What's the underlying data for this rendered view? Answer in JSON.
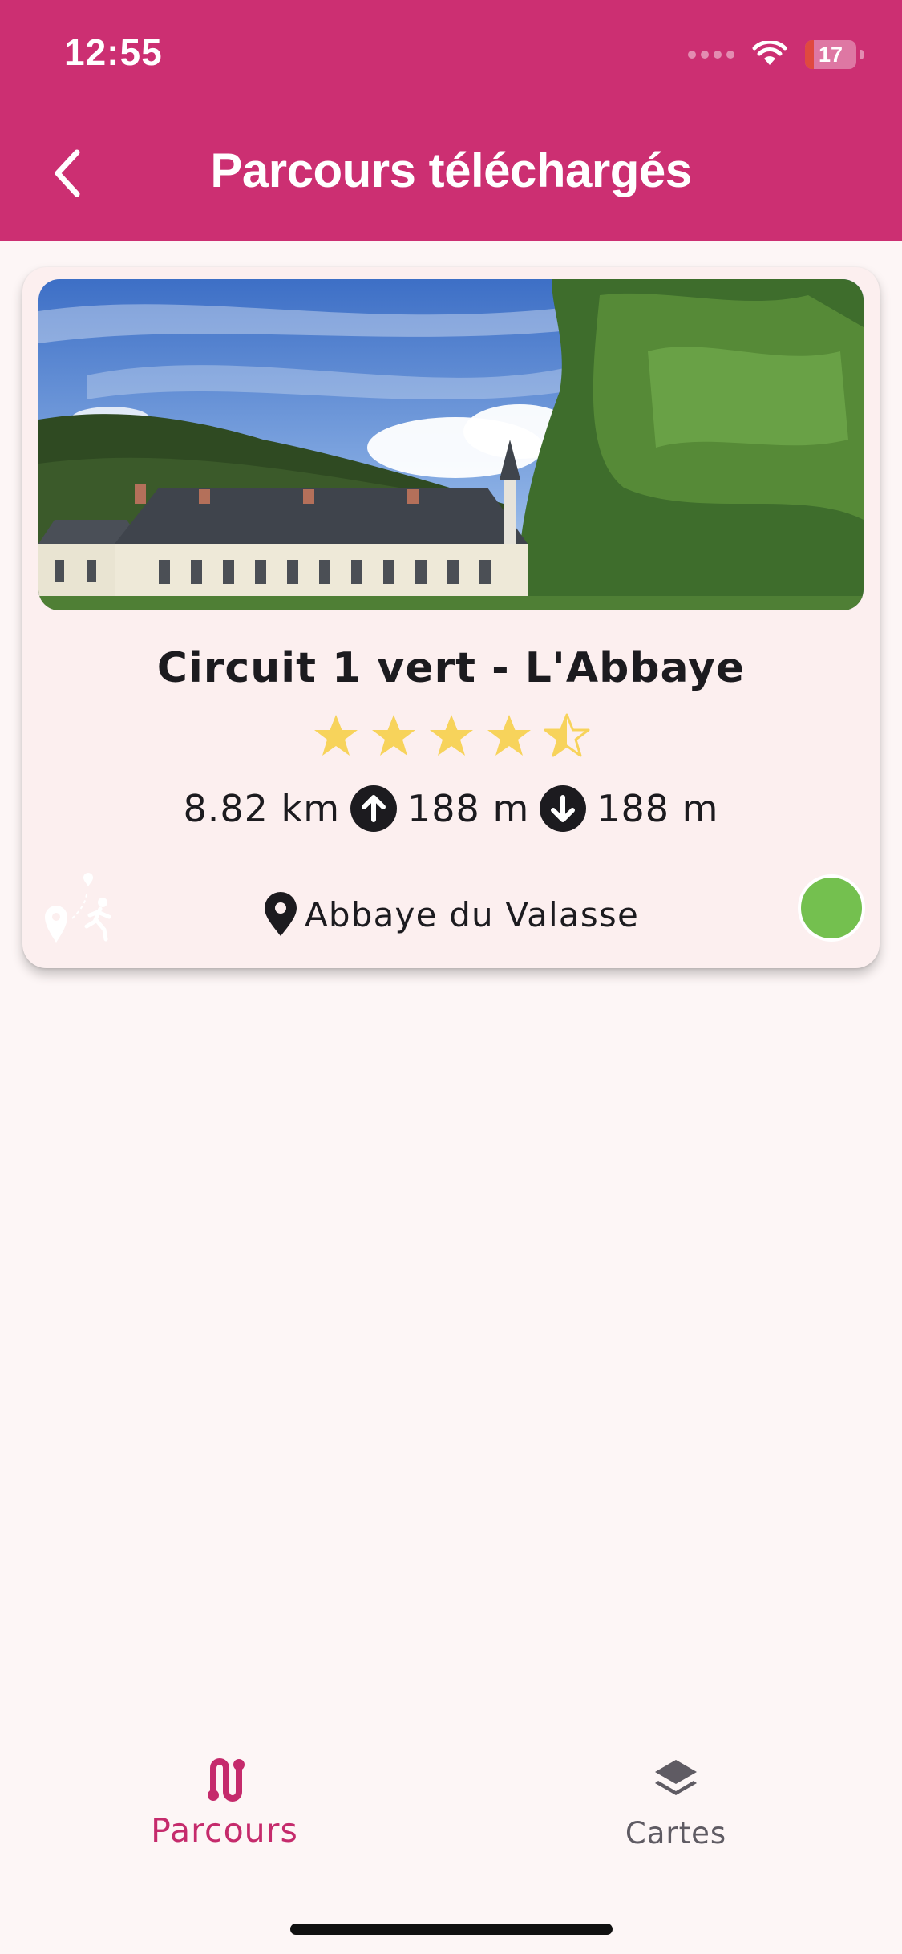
{
  "status_bar": {
    "time": "12:55",
    "battery_level": "17",
    "battery_fraction": 0.17
  },
  "header": {
    "title": "Parcours téléchargés",
    "back_icon": "chevron-left-icon"
  },
  "colors": {
    "header": "#cc2f72",
    "accent": "#c52b6c",
    "card_background": "#fcefef",
    "page_background": "#fdf6f6",
    "star": "#f7d35b",
    "status_dot": "#74c04f"
  },
  "route_card": {
    "title": "Circuit 1 vert - L'Abbaye",
    "rating": 4.5,
    "rating_max": 5,
    "distance": "8.82 km",
    "elevation_gain": "188 m",
    "elevation_loss": "188 m",
    "start_location": "Abbaye du Valasse",
    "status_color": "#74c04f",
    "icons": [
      "route-photo",
      "hiker-map-icon",
      "star-icon",
      "arrow-up-circle-icon",
      "arrow-down-circle-icon",
      "map-pin-icon"
    ]
  },
  "bottom_nav": {
    "items": [
      {
        "label": "Parcours",
        "icon": "route-icon",
        "active": true
      },
      {
        "label": "Cartes",
        "icon": "layers-icon",
        "active": false
      }
    ]
  }
}
